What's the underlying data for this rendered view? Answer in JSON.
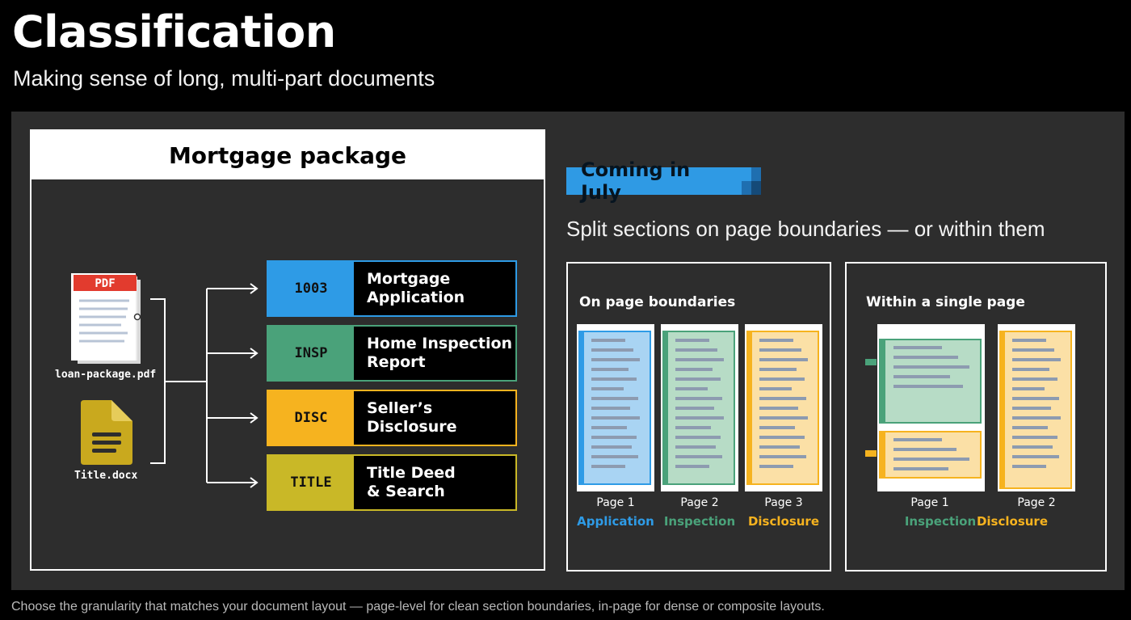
{
  "slide": {
    "title": "Classification",
    "subtitle": "Making sense of long, multi-part documents",
    "footnote": "Choose the granularity that matches your document layout — page-level for clean section boundaries, in-page for dense or composite layouts."
  },
  "package": {
    "title": "Mortgage package",
    "files": [
      {
        "name": "loan-package.pdf",
        "icon": "pdf-icon",
        "badge": "PDF"
      },
      {
        "name": "Title.docx",
        "icon": "docx-icon"
      }
    ],
    "categories": [
      {
        "code": "1003",
        "label": "Mortgage\nApplication",
        "color": "#2e9be6"
      },
      {
        "code": "INSP",
        "label": "Home Inspection\nReport",
        "color": "#4aa27a"
      },
      {
        "code": "DISC",
        "label": "Seller’s\nDisclosure",
        "color": "#f6b31f"
      },
      {
        "code": "TITLE",
        "label": "Title Deed\n& Search",
        "color": "#c9b827"
      }
    ]
  },
  "split": {
    "badge": "Coming in July",
    "heading": "Split sections on page boundaries — or within them",
    "page_boundaries": {
      "title": "On page boundaries",
      "pages": [
        {
          "caption": "Page 1",
          "section": "Application",
          "color": "#2e9be6",
          "fill": "#a9d4f3"
        },
        {
          "caption": "Page 2",
          "section": "Inspection",
          "color": "#4aa27a",
          "fill": "#b7dcc6"
        },
        {
          "caption": "Page 3",
          "section": "Disclosure",
          "color": "#f6b31f",
          "fill": "#fbe0a6"
        }
      ]
    },
    "single_page": {
      "title": "Within a single page",
      "pages": [
        {
          "caption": "Page 1",
          "sections": [
            "Inspection",
            "Disclosure"
          ]
        },
        {
          "caption": "Page 2"
        }
      ],
      "section_colors": {
        "Inspection": "#4aa27a",
        "Disclosure": "#f6b31f"
      }
    }
  },
  "colors": {
    "stage_bg": "#2d2d2d",
    "application": "#2e9be6",
    "inspection": "#4aa27a",
    "disclosure": "#f6b31f",
    "title": "#c9b827"
  }
}
